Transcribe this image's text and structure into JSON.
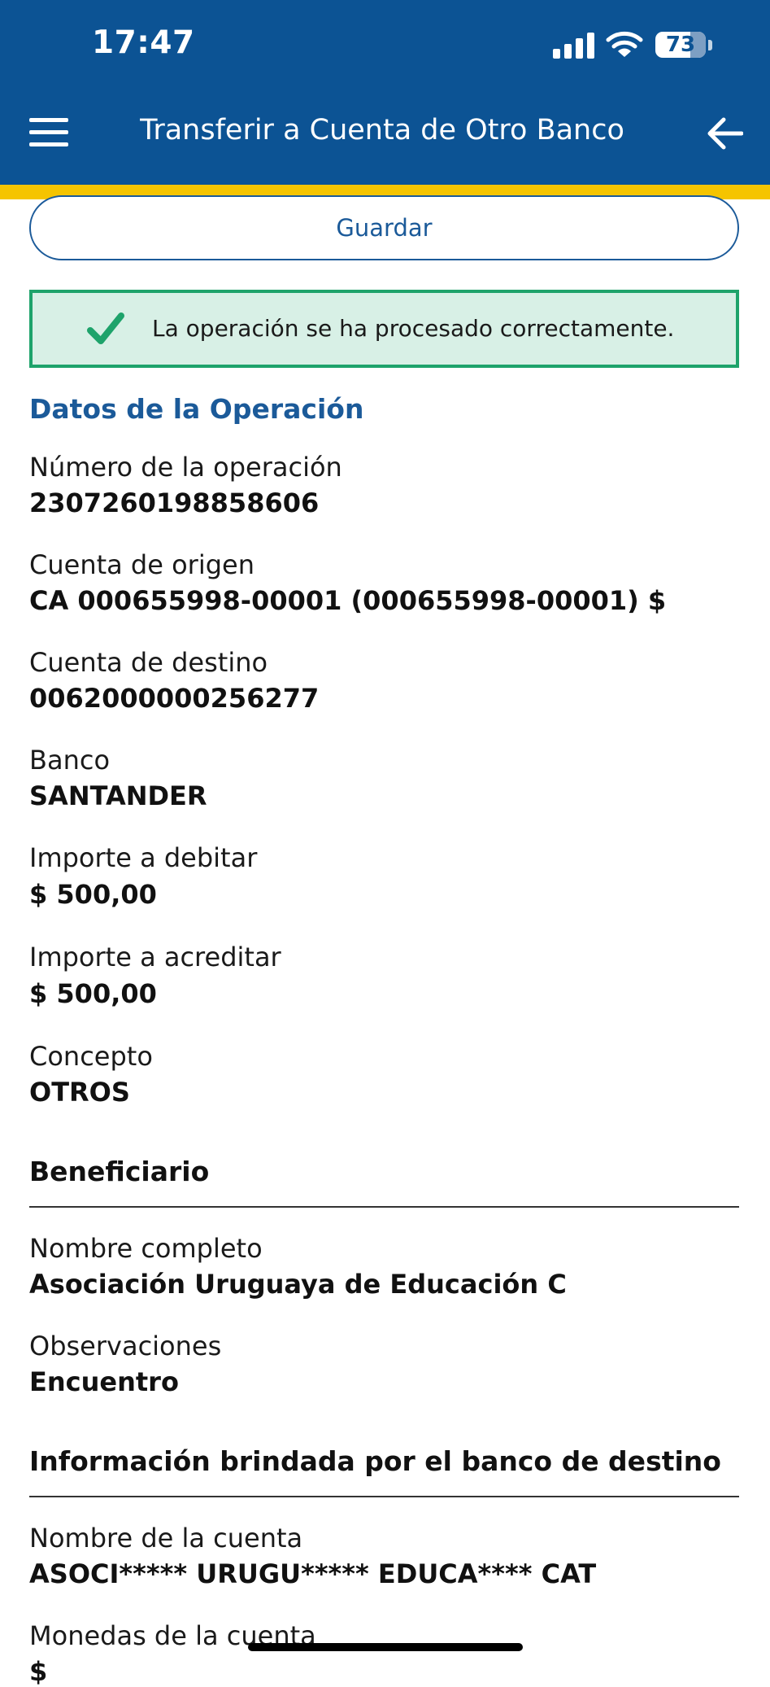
{
  "status_bar": {
    "time": "17:47",
    "battery": "73"
  },
  "header": {
    "title": "Transferir a Cuenta de Otro Banco"
  },
  "actions": {
    "save_label": "Guardar"
  },
  "success_message": "La operación se ha procesado correctamente.",
  "colors": {
    "header_bg": "#0c5394",
    "accent_stripe": "#f5c400",
    "brand_blue": "#1b5a99",
    "success_border": "#1ea36b",
    "success_bg": "#d8f0e6"
  },
  "operation": {
    "title": "Datos de la Operación",
    "fields": [
      {
        "label": "Número de la operación",
        "value": "2307260198858606"
      },
      {
        "label": "Cuenta de origen",
        "value": "CA 000655998-00001 (000655998-00001) $"
      },
      {
        "label": "Cuenta de destino",
        "value": "0062000000256277"
      },
      {
        "label": "Banco",
        "value": "SANTANDER"
      },
      {
        "label": "Importe a debitar",
        "value": "$ 500,00"
      },
      {
        "label": "Importe a acreditar",
        "value": "$ 500,00"
      },
      {
        "label": "Concepto",
        "value": "OTROS"
      }
    ]
  },
  "beneficiary": {
    "title": "Beneficiario",
    "fields": [
      {
        "label": "Nombre completo",
        "value": "Asociación Uruguaya de Educación C"
      },
      {
        "label": "Observaciones",
        "value": "Encuentro"
      }
    ]
  },
  "destination_bank_info": {
    "title": "Información brindada por el banco de destino",
    "fields": [
      {
        "label": "Nombre de la cuenta",
        "value": "ASOCI***** URUGU***** EDUCA**** CAT"
      },
      {
        "label": "Monedas de la cuenta",
        "value": "$"
      }
    ]
  }
}
